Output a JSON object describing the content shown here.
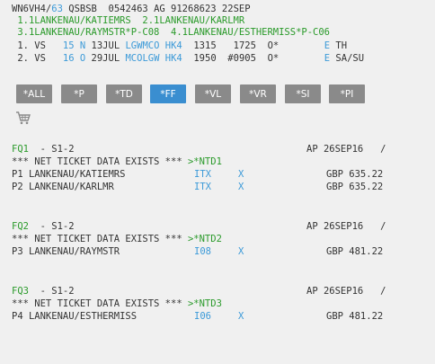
{
  "header": {
    "line1": {
      "a": "WN6VH4/",
      "b": "63",
      "c": " QSBSB  0542463 AG 91268623 22SEP"
    },
    "names1": " 1.1LANKENAU/KATIEMRS  2.1LANKENAU/KARLMR",
    "names2": " 3.1LANKENAU/RAYMSTR*P-C08  4.1LANKENAU/ESTHERMISS*P-C06"
  },
  "segments": [
    {
      "num": " 1.",
      "carrier": " VS",
      "flight": "15",
      "cls": "N",
      "date": " 13JUL",
      "city": "LGWMCO",
      "status": "HK4",
      "dep": "  1315",
      "arr": "   1725",
      "misc": "  O*        ",
      "e": "E",
      "days": " TH"
    },
    {
      "num": " 2.",
      "carrier": " VS",
      "flight": "16",
      "cls": "O",
      "date": " 29JUL",
      "city": "MCOLGW",
      "status": "HK4",
      "dep": "  1950",
      "arr": "  #0905",
      "misc": "  O*        ",
      "e": "E",
      "days": " SA/SU"
    }
  ],
  "toolbar": {
    "buttons": [
      "*ALL",
      "*P",
      "*TD",
      "*FF",
      "*VL",
      "*VR",
      "*SI",
      "*PI"
    ],
    "active": "*FF"
  },
  "fares": [
    {
      "id": "FQ1",
      "seg": "  - S1-2",
      "ap": "AP 26SEP16   /",
      "net_text": "*** NET TICKET DATA EXISTS *** ",
      "ntd": ">*NTD1",
      "pax": [
        {
          "name": "P1 LANKENAU/KATIEMRS",
          "type": "ITX",
          "x": "X",
          "amount": "GBP 635.22"
        },
        {
          "name": "P2 LANKENAU/KARLMR",
          "type": "ITX",
          "x": "X",
          "amount": "GBP 635.22"
        }
      ]
    },
    {
      "id": "FQ2",
      "seg": "  - S1-2",
      "ap": "AP 26SEP16   /",
      "net_text": "*** NET TICKET DATA EXISTS *** ",
      "ntd": ">*NTD2",
      "pax": [
        {
          "name": "P3 LANKENAU/RAYMSTR",
          "type": "I08",
          "x": "X",
          "amount": "GBP 481.22"
        }
      ]
    },
    {
      "id": "FQ3",
      "seg": "  - S1-2",
      "ap": "AP 26SEP16   /",
      "net_text": "*** NET TICKET DATA EXISTS *** ",
      "ntd": ">*NTD3",
      "pax": [
        {
          "name": "P4 LANKENAU/ESTHERMISS",
          "type": "I06",
          "x": "X",
          "amount": "GBP 481.22"
        }
      ]
    }
  ],
  "icons": {
    "cart": "shopping-cart-icon"
  },
  "colors": {
    "green": "#2a9a2a",
    "blue": "#3c9ad8",
    "button": "#8a8a8a",
    "active": "#3a8ed0"
  }
}
